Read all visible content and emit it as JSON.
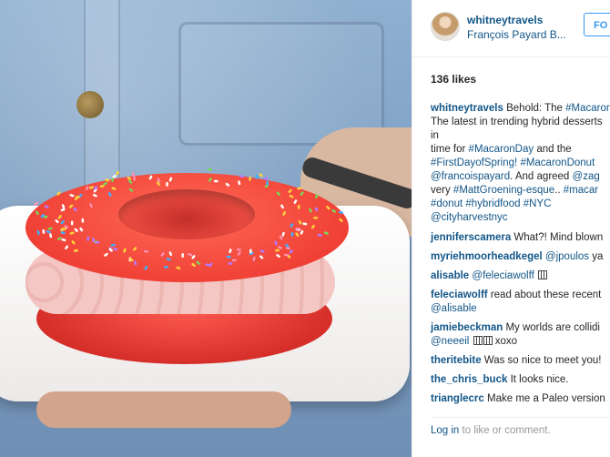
{
  "post": {
    "username": "whitneytravels",
    "location": "François Payard B...",
    "follow_label": "FO",
    "likes": "136 likes"
  },
  "caption": {
    "lines": [
      {
        "user": "whitneytravels",
        "text": " Behold: The ",
        "tag": "#Macaron"
      },
      {
        "text": "The latest in trending hybrid desserts"
      },
      {
        "text": "in"
      },
      {
        "pre": "time for ",
        "tag": "#MacaronDay",
        "post": " and the"
      },
      {
        "tag": "#FirstDayofSpring!",
        "post": " ",
        "tag2": "#MacaronDonut"
      },
      {
        "tag": "@francoispayard",
        "post": ". And agreed ",
        "tag2": "@zag"
      },
      {
        "pre": "very ",
        "tag": "#MattGroening-esque",
        "post": ".. ",
        "tag2": "#macar"
      },
      {
        "tag": "#donut",
        "post": " ",
        "tag2": "#hybridfood",
        "post2": " ",
        "tag3": "#NYC"
      },
      {
        "tag": "@cityharvestnyc"
      }
    ]
  },
  "comments": [
    {
      "user": "jenniferscamera",
      "text": " What?! Mind blown"
    },
    {
      "user": "myriehmoorheadkegel",
      "mention": "@jpoulos",
      "text": " ya"
    },
    {
      "user": "alisable",
      "mention": "@feleciawolff",
      "text": ""
    },
    {
      "user": "feleciawolff",
      "text": " read about these recent"
    },
    {
      "mention": "@alisable",
      "text": ""
    },
    {
      "user": "jamiebeckman",
      "text": " My worlds are collidi"
    },
    {
      "mention": "@neeeil",
      "text": " xoxo"
    },
    {
      "user": "theritebite",
      "text": " Was so nice to meet you!"
    },
    {
      "user": "the_chris_buck",
      "text": " It looks nice."
    },
    {
      "user": "trianglecrc",
      "text": " Make me a Paleo version"
    }
  ],
  "footer": {
    "login_link": "Log in",
    "login_rest": " to like or comment."
  },
  "colors": {
    "link": "#125688",
    "follow": "#3897f0",
    "text": "#262626",
    "muted": "#999999"
  },
  "icons": [
    "avatar-image"
  ]
}
